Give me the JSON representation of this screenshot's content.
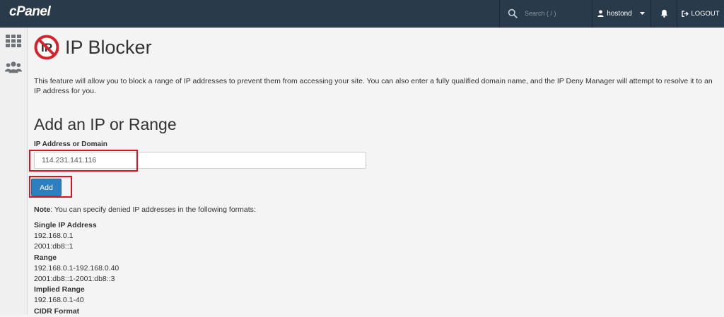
{
  "topbar": {
    "logo": "cPanel",
    "search_placeholder": "Search ( / )",
    "username": "hostond",
    "logout_label": "LOGOUT"
  },
  "colors": {
    "topbar": "#293a4a",
    "accent": "#2d7fc1",
    "highlight": "#e0121b"
  },
  "icons": [
    "search-icon",
    "user-icon",
    "caret-down-icon",
    "bell-icon",
    "logout-icon",
    "grid-icon",
    "users-icon",
    "ip-blocker-icon"
  ],
  "page": {
    "title": "IP Blocker",
    "description": "This feature will allow you to block a range of IP addresses to prevent them from accessing your site. You can also enter a fully qualified domain name, and the IP Deny Manager will attempt to resolve it to an IP address for you."
  },
  "form": {
    "section_title": "Add an IP or Range",
    "field_label": "IP Address or Domain",
    "field_value": "114.231.141.116",
    "add_label": "Add"
  },
  "note": {
    "label": "Note",
    "text": ": You can specify denied IP addresses in the following formats:"
  },
  "formats": [
    {
      "heading": "Single IP Address",
      "examples": [
        "192.168.0.1",
        "2001:db8::1"
      ]
    },
    {
      "heading": "Range",
      "examples": [
        "192.168.0.1-192.168.0.40",
        "2001:db8::1-2001:db8::3"
      ]
    },
    {
      "heading": "Implied Range",
      "examples": [
        "192.168.0.1-40"
      ]
    },
    {
      "heading": "CIDR Format",
      "examples": []
    }
  ]
}
